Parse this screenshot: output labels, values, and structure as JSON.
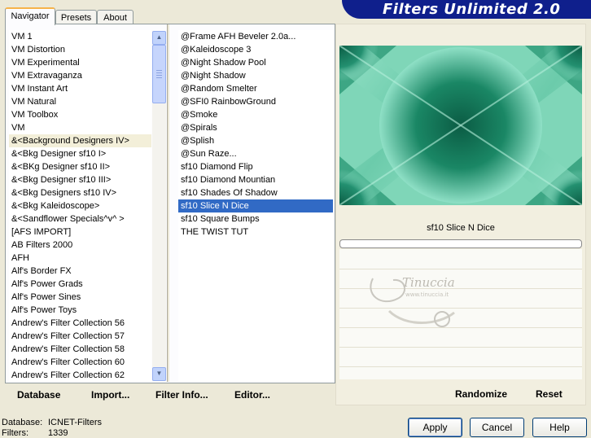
{
  "header": {
    "title": "Filters Unlimited 2.0"
  },
  "tabs": [
    {
      "label": "Navigator",
      "active": true
    },
    {
      "label": "Presets",
      "active": false
    },
    {
      "label": "About",
      "active": false
    }
  ],
  "categories": {
    "items": [
      "VM 1",
      "VM Distortion",
      "VM Experimental",
      "VM Extravaganza",
      "VM Instant Art",
      "VM Natural",
      "VM Toolbox",
      "VM",
      "&<Background Designers IV>",
      "&<Bkg Designer sf10 I>",
      "&<BKg Designer sf10 II>",
      "&<Bkg Designer sf10 III>",
      "&<Bkg Designers sf10 IV>",
      "&<Bkg Kaleidoscope>",
      "&<Sandflower Specials^v^ >",
      "[AFS IMPORT]",
      "AB Filters 2000",
      "AFH",
      "Alf's Border FX",
      "Alf's Power Grads",
      "Alf's Power Sines",
      "Alf's Power Toys",
      "Andrew's Filter Collection 56",
      "Andrew's Filter Collection 57",
      "Andrew's Filter Collection 58",
      "Andrew's Filter Collection 60",
      "Andrew's Filter Collection 62"
    ],
    "selected_index": 8
  },
  "filters": {
    "items": [
      "@Frame AFH Beveler 2.0a...",
      "@Kaleidoscope 3",
      "@Night Shadow Pool",
      "@Night Shadow",
      "@Random Smelter",
      "@SFI0 RainbowGround",
      "@Smoke",
      "@Spirals",
      "@Splish",
      "@Sun Raze...",
      "sf10 Diamond Flip",
      "sf10 Diamond Mountian",
      "sf10 Shades Of Shadow",
      "sf10 Slice N Dice",
      "sf10 Square Bumps",
      "THE TWIST TUT"
    ],
    "selected_index": 13
  },
  "toolbar": {
    "database": "Database",
    "import": "Import...",
    "filter_info": "Filter Info...",
    "editor": "Editor...",
    "randomize": "Randomize",
    "reset": "Reset"
  },
  "preview": {
    "filter_name": "sf10 Slice N Dice",
    "colors": {
      "dark": "#0c6b50",
      "mid": "#3aa886",
      "light": "#8fe0c6"
    }
  },
  "watermark": {
    "text": "Tinuccia",
    "subtext": "www.tinuccia.it"
  },
  "status": {
    "database_label": "Database:",
    "database_value": "ICNET-Filters",
    "filters_label": "Filters:",
    "filters_value": "1339"
  },
  "buttons": {
    "apply": "Apply",
    "cancel": "Cancel",
    "help": "Help"
  }
}
